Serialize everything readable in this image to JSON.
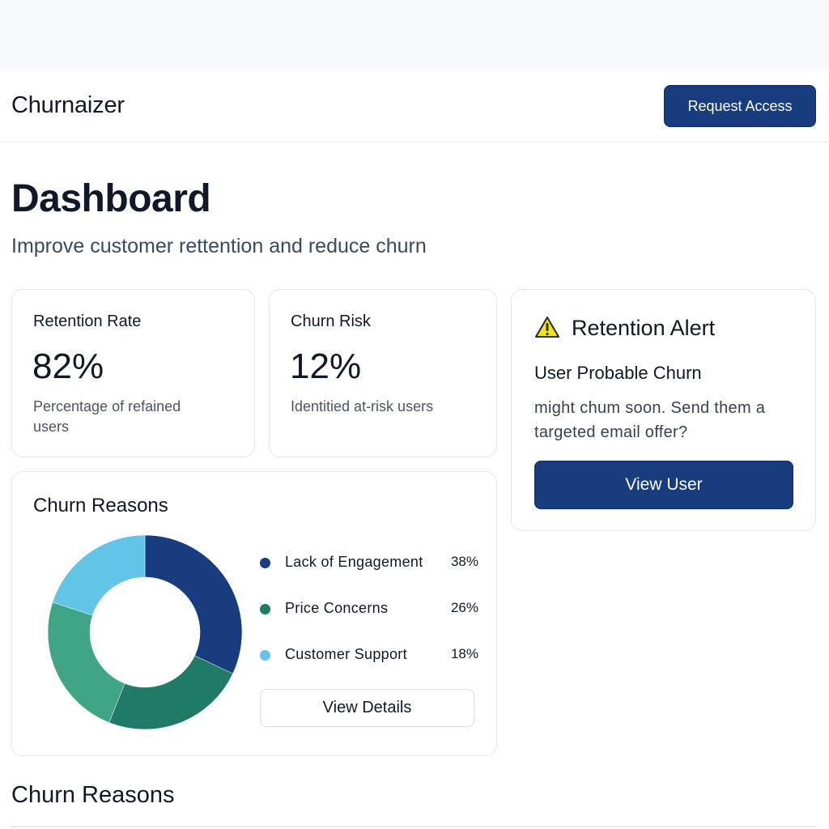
{
  "header": {
    "brand": "Churnaizer",
    "request_access_label": "Request Access"
  },
  "page": {
    "title": "Dashboard",
    "subtitle": "Improve customer rettention and reduce churn"
  },
  "stats": {
    "retention": {
      "label": "Retention Rate",
      "value": "82%",
      "description": "Percentage of refained users"
    },
    "churn": {
      "label": "Churn Risk",
      "value": "12%",
      "description": "Identitied at-risk users"
    }
  },
  "alert": {
    "icon": "warning-icon",
    "title": "Retention Alert",
    "subtitle": "User Probable Churn",
    "text": "might chum soon. Send them a targeted email offer?",
    "button_label": "View User"
  },
  "reasons_card": {
    "title": "Churn Reasons",
    "view_details_label": "View Details"
  },
  "chart_data": {
    "type": "pie",
    "donut": true,
    "title": "Churn Reasons",
    "categories": [
      "Lack of Engagement",
      "Price Concerns",
      "Customer Support"
    ],
    "values": [
      38,
      26,
      18
    ],
    "value_labels": [
      "38%",
      "26%",
      "18%"
    ],
    "colors": [
      "#173d7e",
      "#1f7a66",
      "#62c4e6"
    ],
    "rendered_segments": [
      {
        "color": "#173d7e",
        "value": 32
      },
      {
        "color": "#1f7a66",
        "value": 24
      },
      {
        "color": "#3fa585",
        "value": 24
      },
      {
        "color": "#62c4e6",
        "value": 20
      }
    ]
  },
  "section": {
    "title": "Churn Reasons"
  }
}
